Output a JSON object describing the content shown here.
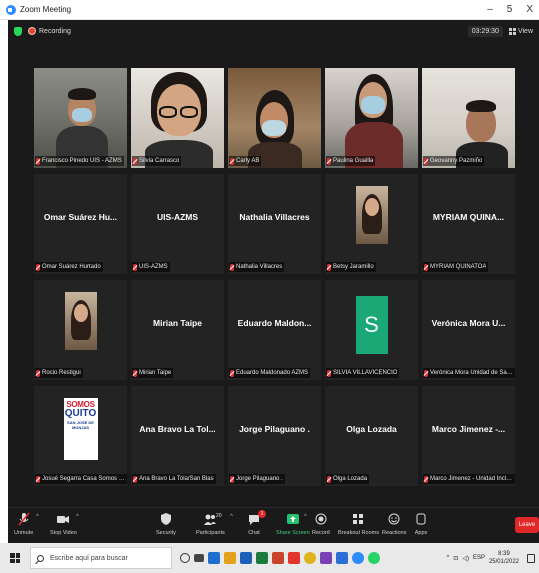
{
  "window": {
    "title": "Zoom Meeting",
    "minimize": "–",
    "restore": "5",
    "close": "X"
  },
  "meeting": {
    "recording_label": "Recording",
    "timer": "03:29:30",
    "view_label": "View"
  },
  "participants": [
    {
      "display": "Francisco Pinedo UIS - AZMS",
      "center": "",
      "kind": "video",
      "style": "v1",
      "active": false
    },
    {
      "display": "Silvia Carrasco",
      "center": "",
      "kind": "video",
      "style": "v2",
      "active": false
    },
    {
      "display": "Carly AB",
      "center": "",
      "kind": "video",
      "style": "v3",
      "active": true
    },
    {
      "display": "Paulina Guailla",
      "center": "",
      "kind": "video",
      "style": "v4",
      "active": false
    },
    {
      "display": "Geovanny Pazmiño",
      "center": "",
      "kind": "video",
      "style": "v5",
      "active": false
    },
    {
      "display": "Omar Suárez Hurtado",
      "center": "Omar Suárez Hu...",
      "kind": "name",
      "active": false
    },
    {
      "display": "UIS-AZMS",
      "center": "UIS-AZMS",
      "kind": "name",
      "active": false
    },
    {
      "display": "Nathalia Villacres",
      "center": "Nathalia Villacres",
      "kind": "name",
      "active": false
    },
    {
      "display": "Betsy Jaramillo",
      "center": "",
      "kind": "photo",
      "active": false
    },
    {
      "display": "MYRIAM QUINATOA",
      "center": "MYRIAM QUINA...",
      "kind": "name",
      "active": false
    },
    {
      "display": "Rocio Restigui",
      "center": "",
      "kind": "photo",
      "active": false
    },
    {
      "display": "Mirian Taipe",
      "center": "Mirian Taipe",
      "kind": "name",
      "active": false
    },
    {
      "display": "Eduardo Maldonado AZMS",
      "center": "Eduardo Maldon...",
      "kind": "name",
      "active": false
    },
    {
      "display": "SILVIA VILLAVICENCIO",
      "center": "",
      "kind": "avatar",
      "avatar_letter": "S",
      "active": false
    },
    {
      "display": "Verónica Mora Unidad de Salud AZ...",
      "center": "Verónica Mora U...",
      "kind": "name",
      "active": false
    },
    {
      "display": "Josué Segarra Casa Somos San Jo...",
      "center": "",
      "kind": "logo",
      "logo": {
        "l1": "SOMOS",
        "l2": "QUITO",
        "l3": "SAN JOSÉ DE MONJAS"
      },
      "active": false
    },
    {
      "display": "Ana Bravo La Tola/San Blas",
      "center": "Ana Bravo La Tol...",
      "kind": "name",
      "active": false
    },
    {
      "display": "Jorge Pilaguano .",
      "center": "Jorge Pilaguano .",
      "kind": "name",
      "active": false
    },
    {
      "display": "Olga Lozada",
      "center": "Olga Lozada",
      "kind": "name",
      "active": false
    },
    {
      "display": "Marco Jimenez - Unidad Inclusion ...",
      "center": "Marco Jimenez -...",
      "kind": "name",
      "active": false
    }
  ],
  "toolbar": {
    "unmute": "Unmute",
    "stop_video": "Stop Video",
    "security": "Security",
    "participants": "Participants",
    "participants_count": "20",
    "chat": "Chat",
    "chat_badge": "1",
    "share_screen": "Share Screen",
    "record": "Record",
    "breakout": "Breakout Rooms",
    "reactions": "Reactions",
    "apps": "Apps",
    "leave": "Leave"
  },
  "taskbar": {
    "search_placeholder": "Escribe aquí para buscar",
    "lang": "ESP",
    "time": "8:39",
    "date": "25/01/2022"
  }
}
